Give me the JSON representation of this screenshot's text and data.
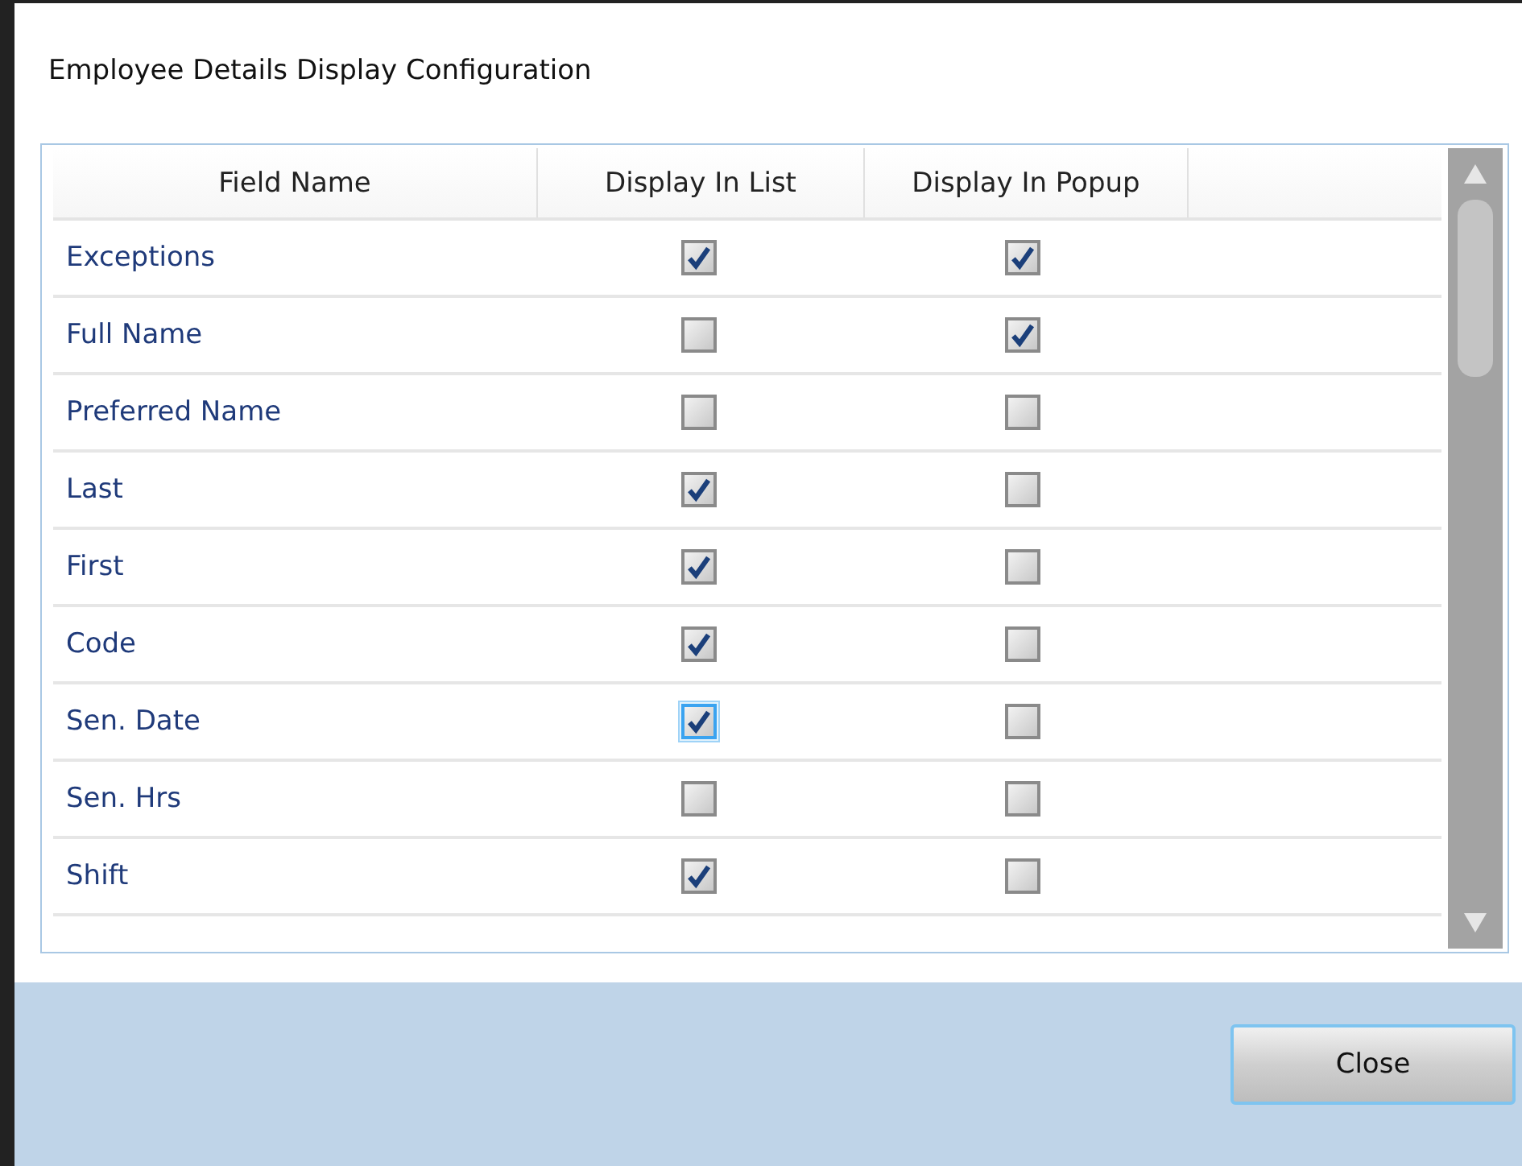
{
  "window": {
    "title": "Employee Details Display Configuration"
  },
  "table": {
    "columns": [
      "Field Name",
      "Display In List",
      "Display In Popup"
    ],
    "rows": [
      {
        "field": "Exceptions",
        "in_list": true,
        "in_popup": true,
        "focused": false
      },
      {
        "field": "Full Name",
        "in_list": false,
        "in_popup": true,
        "focused": false
      },
      {
        "field": "Preferred Name",
        "in_list": false,
        "in_popup": false,
        "focused": false
      },
      {
        "field": "Last",
        "in_list": true,
        "in_popup": false,
        "focused": false
      },
      {
        "field": "First",
        "in_list": true,
        "in_popup": false,
        "focused": false
      },
      {
        "field": "Code",
        "in_list": true,
        "in_popup": false,
        "focused": false
      },
      {
        "field": "Sen. Date",
        "in_list": true,
        "in_popup": false,
        "focused": true
      },
      {
        "field": "Sen. Hrs",
        "in_list": false,
        "in_popup": false,
        "focused": false
      },
      {
        "field": "Shift",
        "in_list": true,
        "in_popup": false,
        "focused": false
      }
    ]
  },
  "buttons": [
    "Close"
  ]
}
